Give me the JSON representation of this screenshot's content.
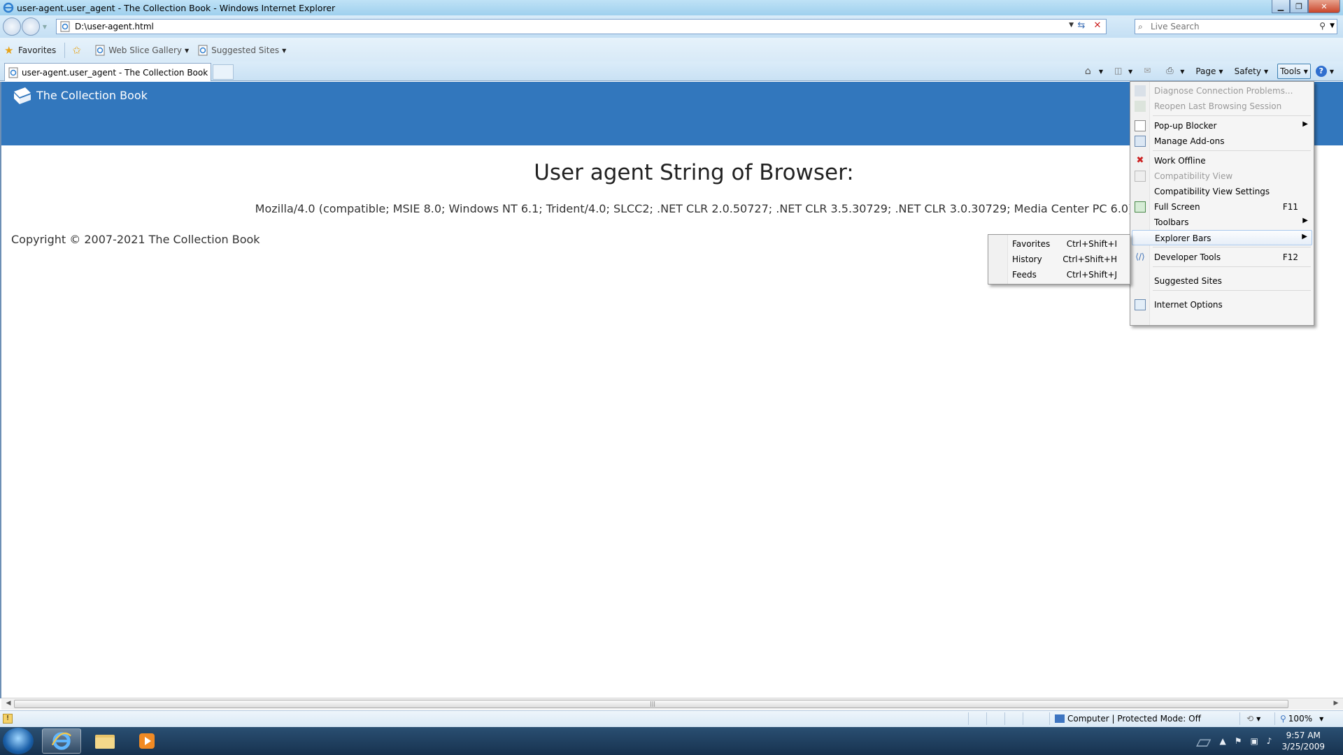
{
  "window": {
    "title": "user-agent.user_agent - The Collection Book - Windows Internet Explorer"
  },
  "address_bar": {
    "url": "D:\\user-agent.html"
  },
  "search": {
    "placeholder": "Live Search"
  },
  "favorites_bar": {
    "favorites_label": "Favorites",
    "web_slice_gallery": "Web Slice Gallery",
    "suggested_sites": "Suggested Sites"
  },
  "tab": {
    "title": "user-agent.user_agent - The Collection Book"
  },
  "command_bar": {
    "page": "Page",
    "safety": "Safety",
    "tools": "Tools"
  },
  "page": {
    "brand": "The Collection Book",
    "headline": "User agent String of Browser:",
    "ua_string": "Mozilla/4.0 (compatible; MSIE 8.0; Windows NT 6.1; Trident/4.0; SLCC2; .NET CLR 2.0.50727; .NET CLR 3.5.30729; .NET CLR 3.0.30729; Media Center PC 6.0)",
    "copyright": "Copyright © 2007-2021 The Collection Book"
  },
  "tools_menu": {
    "items": [
      {
        "label": "Diagnose Connection Problems...",
        "disabled": true
      },
      {
        "label": "Reopen Last Browsing Session",
        "disabled": true
      },
      {
        "label": "Pop-up Blocker"
      },
      {
        "label": "Manage Add-ons"
      },
      {
        "label": "Work Offline"
      },
      {
        "label": "Compatibility View",
        "disabled": true
      },
      {
        "label": "Compatibility View Settings"
      },
      {
        "label": "Full Screen",
        "shortcut": "F11"
      },
      {
        "label": "Toolbars"
      },
      {
        "label": "Explorer Bars"
      },
      {
        "label": "Developer Tools",
        "shortcut": "F12"
      },
      {
        "label": "Suggested Sites"
      },
      {
        "label": "Internet Options"
      }
    ]
  },
  "explorer_bars_menu": {
    "items": [
      {
        "label": "Favorites",
        "shortcut": "Ctrl+Shift+I"
      },
      {
        "label": "History",
        "shortcut": "Ctrl+Shift+H"
      },
      {
        "label": "Feeds",
        "shortcut": "Ctrl+Shift+J"
      }
    ]
  },
  "status_bar": {
    "zone": "Computer | Protected Mode: Off",
    "zoom": "100%"
  },
  "taskbar": {
    "time": "9:57 AM",
    "date": "3/25/2009"
  },
  "colors": {
    "header_blue": "#3277bd",
    "disabled_text": "#9a9a9a"
  }
}
